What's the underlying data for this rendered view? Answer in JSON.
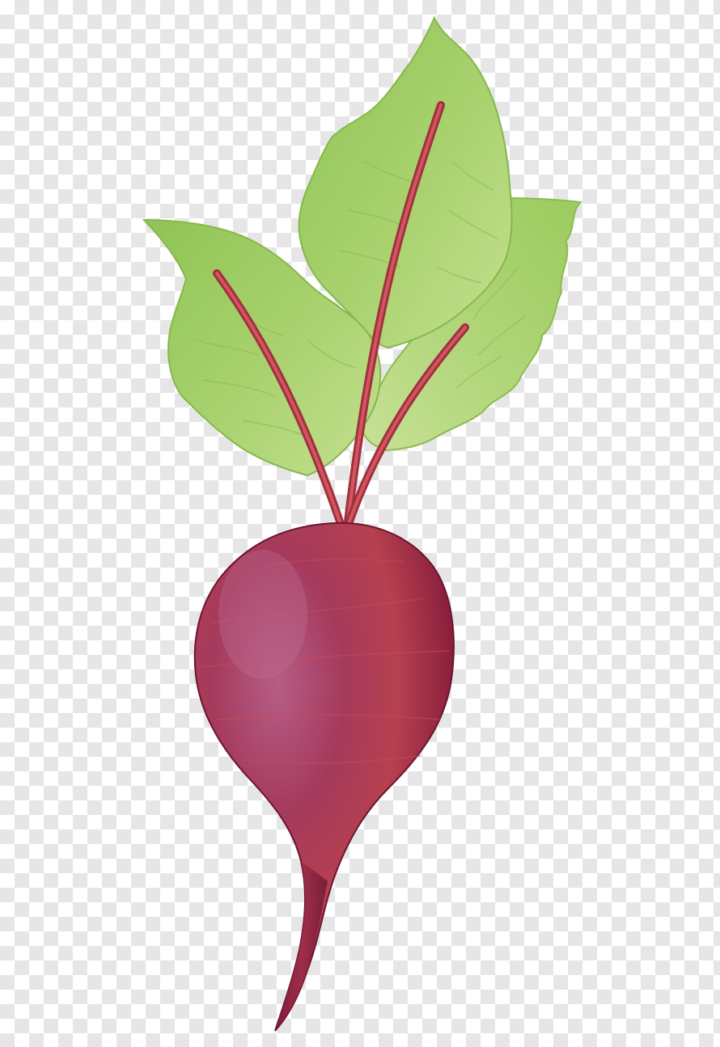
{
  "background": {
    "pattern": "transparency-checkerboard",
    "colors": {
      "light": "#ffffff",
      "dark": "#e6e6e6"
    }
  },
  "illustration": {
    "subject": "beetroot",
    "colors": {
      "leaf_light": "#b5d77a",
      "leaf_mid": "#9ccb5e",
      "leaf_dark": "#78a93c",
      "vein": "#c2474f",
      "root_highlight": "#b2577f",
      "root_mid": "#a0294a",
      "root_dark": "#6e1733",
      "root_band": "#c94a56"
    }
  }
}
